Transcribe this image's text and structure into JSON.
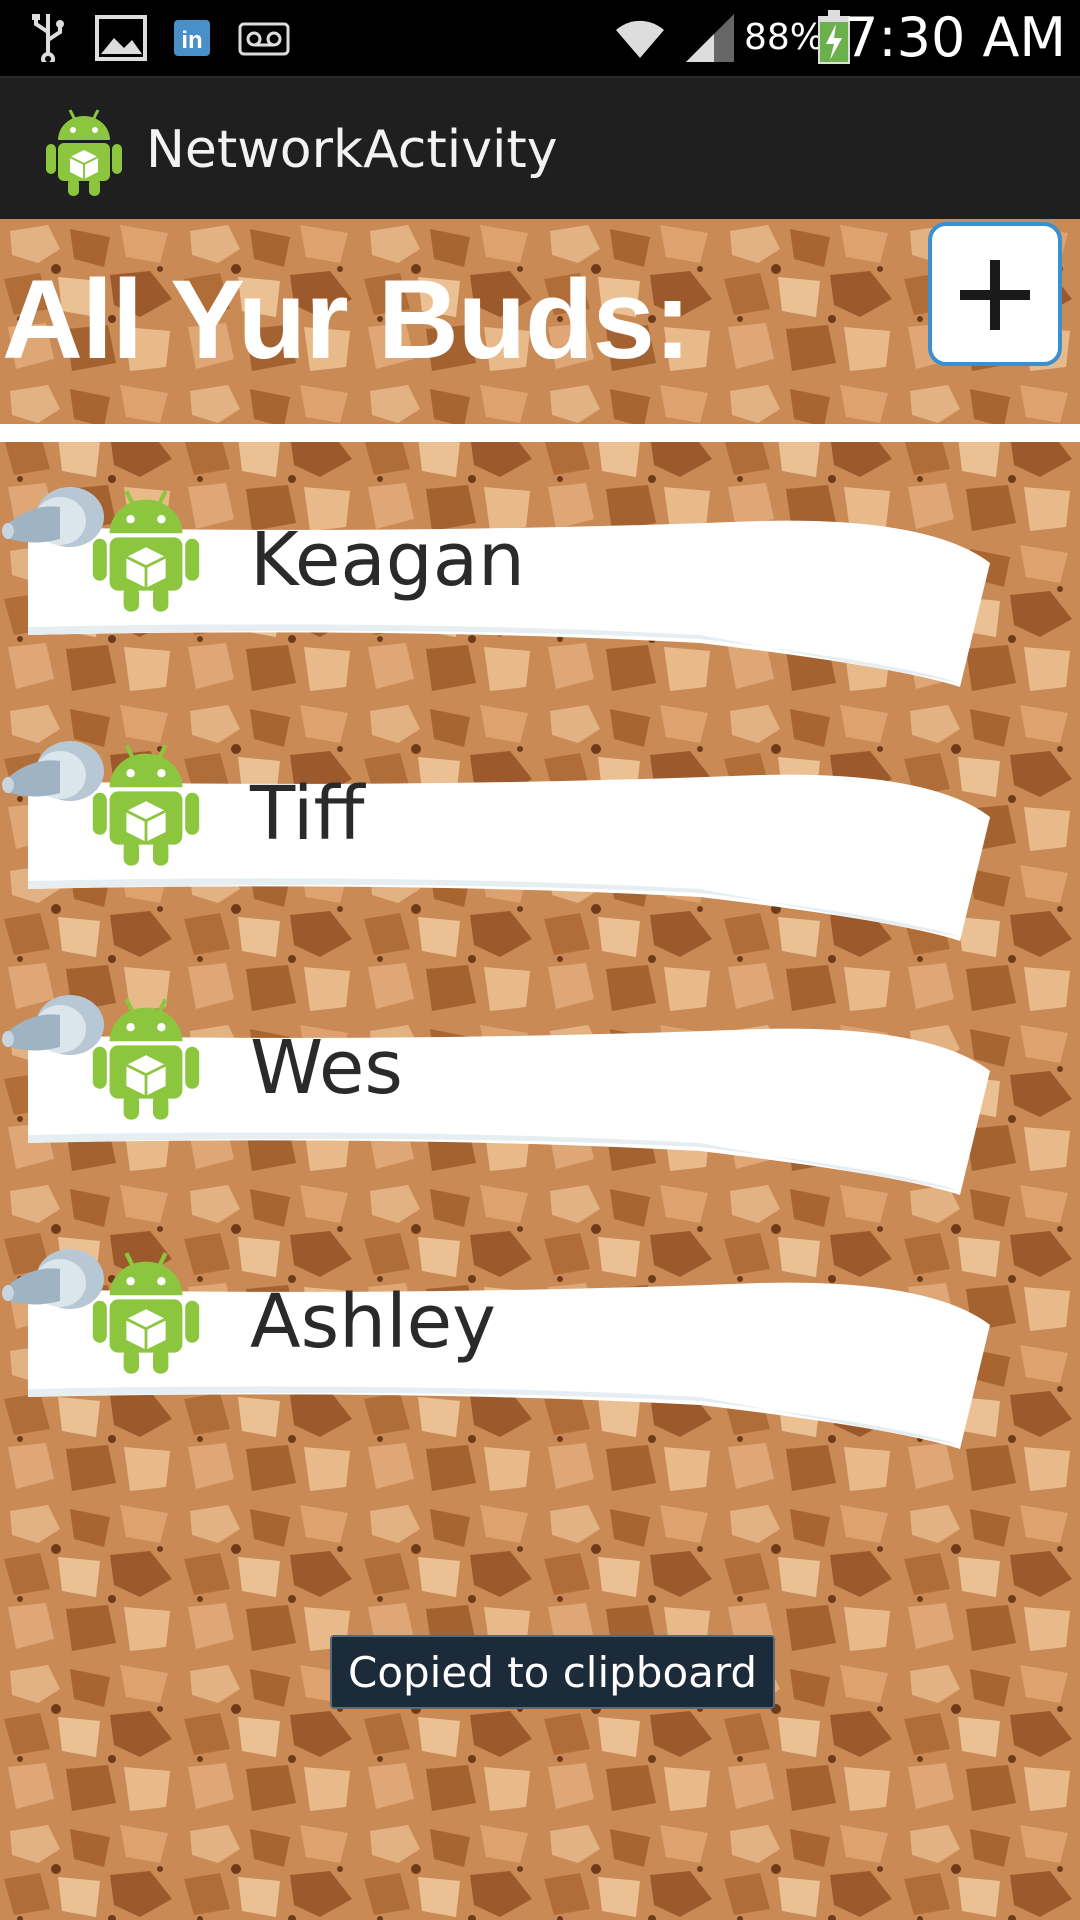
{
  "status_bar": {
    "icons": [
      "usb-icon",
      "image-icon",
      "linkedin-icon",
      "voicemail-icon",
      "wifi-icon",
      "signal-icon",
      "battery-charging-icon"
    ],
    "battery_percent": "88%",
    "time": "7:30 AM"
  },
  "action_bar": {
    "title": "NetworkActivity",
    "icon": "android-app-icon"
  },
  "main": {
    "heading": "All Yur Buds:",
    "add_button_icon": "plus-icon",
    "buddies": [
      {
        "name": "Keagan",
        "icon": "android-icon"
      },
      {
        "name": "Tiff",
        "icon": "android-icon"
      },
      {
        "name": "Wes",
        "icon": "android-icon"
      },
      {
        "name": "Ashley",
        "icon": "android-icon"
      }
    ]
  },
  "toast": {
    "text": "Copied to clipboard"
  },
  "colors": {
    "status_bar": "#000000",
    "action_bar": "#1f1f1f",
    "cork": "#c98a55",
    "add_button_border": "#3a8fd0",
    "android_green": "#8cc63f",
    "toast_bg": "#1c2b3a"
  }
}
